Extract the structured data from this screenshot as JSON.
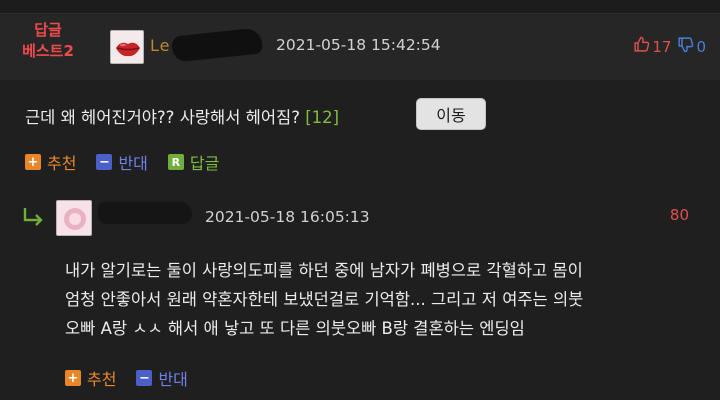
{
  "best_comment": {
    "badge_line1": "답글",
    "badge_line2": "베스트2",
    "username": "Le          er",
    "date": "2021-05-18 15:42:54",
    "upvotes": "17",
    "downvotes": "0",
    "text": "근데 왜 헤어진거야?? 사랑해서 헤어짐?",
    "reply_count": "[12]",
    "move_button": "이동",
    "actions": {
      "recommend": "추천",
      "oppose": "반대",
      "reply": "답글",
      "reply_icon_letter": "R"
    }
  },
  "reply": {
    "username": "",
    "date": "2021-05-18 16:05:13",
    "score": "80",
    "lines": [
      "내가 알기로는 둘이 사랑의도피를 하던 중에 남자가 폐병으로 각혈하고 몸이",
      "엄청 안좋아서 원래 약혼자한테 보냈던걸로 기억함... 그리고 저 여주는 의붓",
      "오빠 A랑 ㅅㅅ 해서 애 낳고 또 다른 의붓오빠 B랑 결혼하는 엔딩임"
    ],
    "actions": {
      "recommend": "추천",
      "oppose": "반대"
    }
  },
  "icons": {
    "thumbs_up": "thumbs-up-icon",
    "thumbs_down": "thumbs-down-icon",
    "reply_arrow": "reply-arrow-icon"
  },
  "colors": {
    "background": "#1f1f1f",
    "header_bg": "#262626",
    "best_red": "#ef4b4b",
    "recommend_orange": "#e8872a",
    "oppose_blue": "#4a5fc8",
    "reply_green": "#6fae3a"
  }
}
